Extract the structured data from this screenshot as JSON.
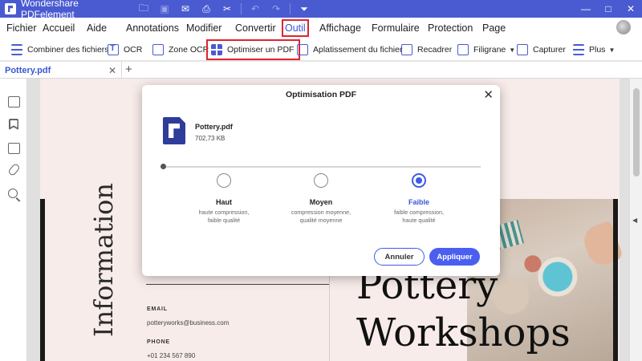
{
  "titlebar": {
    "title": "Wondershare PDFelement",
    "icons": [
      "folder-icon",
      "save-icon",
      "mail-icon",
      "print-icon",
      "scissors-icon",
      "undo-icon",
      "redo-icon",
      "quick-access-icon"
    ],
    "glyphs": {
      "folder": "🗀",
      "save": "▣",
      "mail": "✉",
      "print": "⎙",
      "scissors": "✂",
      "undo": "↶",
      "redo": "↷",
      "quick": "⏷",
      "minimize": "—",
      "maximize": "□",
      "close": "✕"
    }
  },
  "menu": {
    "items": [
      "Fichier",
      "Accueil",
      "Aide",
      "Annotations",
      "Modifier",
      "Convertir",
      "Outil",
      "Affichage",
      "Formulaire",
      "Protection",
      "Page"
    ],
    "active": "Outil"
  },
  "toolbar": {
    "combine": "Combiner des fichiers",
    "ocr": "OCR",
    "zone_ocr": "Zone OCR",
    "optimize": "Optimiser un PDF",
    "flatten": "Aplatissement du fichier",
    "crop": "Recadrer",
    "watermark": "Filigrane",
    "capture": "Capturer",
    "more": "Plus"
  },
  "tabs": {
    "doc_name": "Pottery.pdf",
    "close_glyph": "✕",
    "add_glyph": "+"
  },
  "document": {
    "vertical_title": "Information",
    "email_label": "EMAIL",
    "email_value": "potteryworks@business.com",
    "phone_label": "PHONE",
    "phone_value": "+01 234 567 890",
    "title_line1": "Pottery",
    "title_line2": "Workshops"
  },
  "modal": {
    "title": "Optimisation PDF",
    "close_glyph": "✕",
    "file_name": "Pottery.pdf",
    "file_size": "702,73 KB",
    "options": [
      {
        "label": "Haut",
        "desc1": "haute compression,",
        "desc2": "faible qualité"
      },
      {
        "label": "Moyen",
        "desc1": "compression moyenne,",
        "desc2": "qualité moyenne"
      },
      {
        "label": "Faible",
        "desc1": "faible compression,",
        "desc2": "haute qualité"
      }
    ],
    "selected": "Faible",
    "cancel": "Annuler",
    "apply": "Appliquer"
  },
  "colors": {
    "brand": "#4a5bd1",
    "accent": "#3e5ce6",
    "highlight_box": "#e0242f"
  }
}
